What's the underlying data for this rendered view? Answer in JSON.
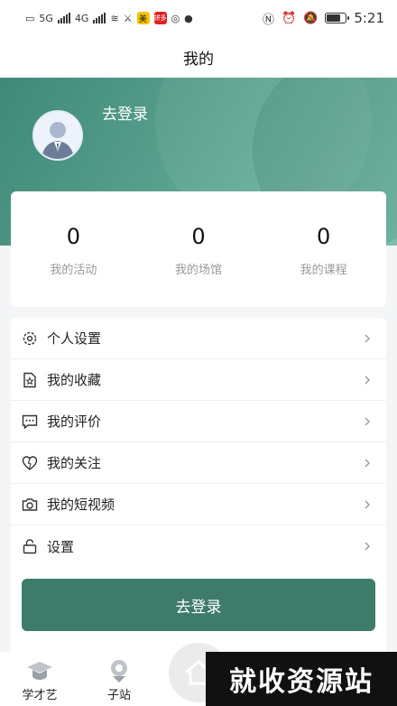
{
  "status_bar": {
    "network_labels": [
      "5G",
      "4G"
    ],
    "app_badges": [
      "美",
      "拼多"
    ],
    "time": "5:21",
    "battery_level_percent": 75
  },
  "header": {
    "title": "我的"
  },
  "profile": {
    "login_text": "去登录"
  },
  "stats": [
    {
      "value": "0",
      "label": "我的活动"
    },
    {
      "value": "0",
      "label": "我的场馆"
    },
    {
      "value": "0",
      "label": "我的课程"
    }
  ],
  "menu": [
    {
      "label": "个人设置",
      "icon": "gear-icon"
    },
    {
      "label": "我的收藏",
      "icon": "star-doc-icon"
    },
    {
      "label": "我的评价",
      "icon": "comment-icon"
    },
    {
      "label": "我的关注",
      "icon": "heart-icon"
    },
    {
      "label": "我的短视频",
      "icon": "camera-icon"
    },
    {
      "label": "设置",
      "icon": "lock-icon"
    }
  ],
  "login_button": {
    "label": "去登录"
  },
  "tabs": [
    {
      "label": "学才艺",
      "icon": "graduation-cap-icon"
    },
    {
      "label": "子站",
      "icon": "location-pin-icon"
    }
  ],
  "watermark": {
    "text": "就收资源站"
  },
  "colors": {
    "brand_green": "#3f7b6a",
    "hero_start": "#3f8977",
    "hero_end": "#7cbeac"
  }
}
